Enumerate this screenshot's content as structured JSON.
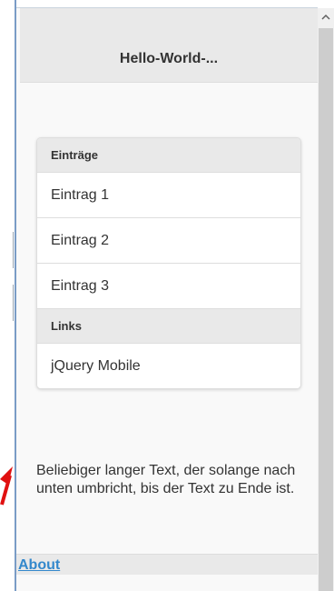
{
  "header": {
    "title": "Hello-World-..."
  },
  "list": {
    "dividers": [
      "Einträge",
      "Links"
    ],
    "entries": [
      "Eintrag 1",
      "Eintrag 2",
      "Eintrag 3"
    ],
    "links": [
      "jQuery Mobile"
    ]
  },
  "content": {
    "text": "Beliebiger langer Text, der solange nach unten umbricht, bis der Text zu Ende ist."
  },
  "footer": {
    "link": "About"
  },
  "colors": {
    "accent": "#3388cc",
    "arrow": "#e01010",
    "header_bg": "#e9e9e9"
  },
  "icons": {
    "scroll_up": "chevron-up-icon",
    "annotation": "red-arrow-icon"
  }
}
